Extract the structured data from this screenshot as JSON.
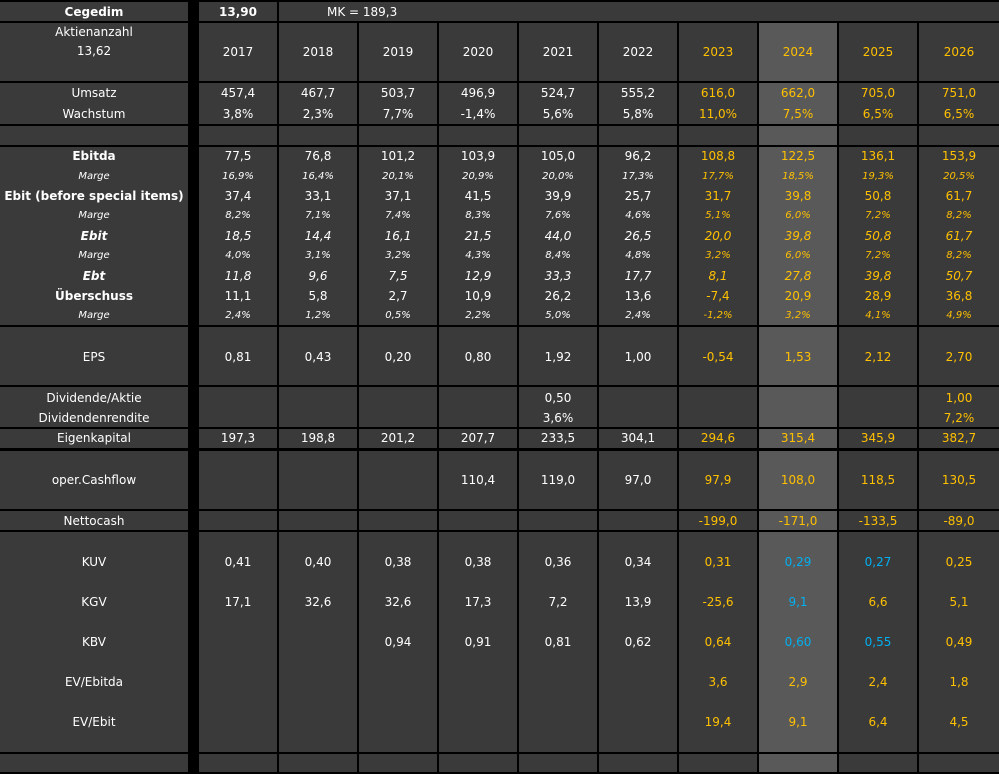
{
  "header": {
    "company": "Cegedim",
    "price": "13,90",
    "market_cap": "MK = 189,3",
    "shares_label": "Aktienanzahl",
    "shares_value": "13,62"
  },
  "years": [
    "2017",
    "2018",
    "2019",
    "2020",
    "2021",
    "2022",
    "2023",
    "2024",
    "2025",
    "2026"
  ],
  "rows": [
    {
      "label": "Umsatz",
      "values": [
        "457,4",
        "467,7",
        "503,7",
        "496,9",
        "524,7",
        "555,2",
        "616,0",
        "662,0",
        "705,0",
        "751,0"
      ]
    },
    {
      "label": "Wachstum",
      "values": [
        "3,8%",
        "2,3%",
        "7,7%",
        "-1,4%",
        "5,6%",
        "5,8%",
        "11,0%",
        "7,5%",
        "6,5%",
        "6,5%"
      ]
    },
    {
      "label": "Ebitda",
      "values": [
        "77,5",
        "76,8",
        "101,2",
        "103,9",
        "105,0",
        "96,2",
        "108,8",
        "122,5",
        "136,1",
        "153,9"
      ]
    },
    {
      "label": "Marge",
      "values": [
        "16,9%",
        "16,4%",
        "20,1%",
        "20,9%",
        "20,0%",
        "17,3%",
        "17,7%",
        "18,5%",
        "19,3%",
        "20,5%"
      ]
    },
    {
      "label": "Ebit (before special items)",
      "values": [
        "37,4",
        "33,1",
        "37,1",
        "41,5",
        "39,9",
        "25,7",
        "31,7",
        "39,8",
        "50,8",
        "61,7"
      ]
    },
    {
      "label": "Marge",
      "values": [
        "8,2%",
        "7,1%",
        "7,4%",
        "8,3%",
        "7,6%",
        "4,6%",
        "5,1%",
        "6,0%",
        "7,2%",
        "8,2%"
      ]
    },
    {
      "label": "Ebit",
      "values": [
        "18,5",
        "14,4",
        "16,1",
        "21,5",
        "44,0",
        "26,5",
        "20,0",
        "39,8",
        "50,8",
        "61,7"
      ]
    },
    {
      "label": "Marge",
      "values": [
        "4,0%",
        "3,1%",
        "3,2%",
        "4,3%",
        "8,4%",
        "4,8%",
        "3,2%",
        "6,0%",
        "7,2%",
        "8,2%"
      ]
    },
    {
      "label": "Ebt",
      "values": [
        "11,8",
        "9,6",
        "7,5",
        "12,9",
        "33,3",
        "17,7",
        "8,1",
        "27,8",
        "39,8",
        "50,7"
      ]
    },
    {
      "label": "Überschuss",
      "values": [
        "11,1",
        "5,8",
        "2,7",
        "10,9",
        "26,2",
        "13,6",
        "-7,4",
        "20,9",
        "28,9",
        "36,8"
      ]
    },
    {
      "label": "Marge",
      "values": [
        "2,4%",
        "1,2%",
        "0,5%",
        "2,2%",
        "5,0%",
        "2,4%",
        "-1,2%",
        "3,2%",
        "4,1%",
        "4,9%"
      ]
    },
    {
      "label": "EPS",
      "values": [
        "0,81",
        "0,43",
        "0,20",
        "0,80",
        "1,92",
        "1,00",
        "-0,54",
        "1,53",
        "2,12",
        "2,70"
      ]
    },
    {
      "label": "Dividende/Aktie",
      "values": [
        "",
        "",
        "",
        "",
        "0,50",
        "",
        "",
        "",
        "",
        "1,00"
      ]
    },
    {
      "label": "Dividendenrendite",
      "values": [
        "",
        "",
        "",
        "",
        "3,6%",
        "",
        "",
        "",
        "",
        "7,2%"
      ]
    },
    {
      "label": "Eigenkapital",
      "values": [
        "197,3",
        "198,8",
        "201,2",
        "207,7",
        "233,5",
        "304,1",
        "294,6",
        "315,4",
        "345,9",
        "382,7"
      ]
    },
    {
      "label": "oper.Cashflow",
      "values": [
        "",
        "",
        "",
        "110,4",
        "119,0",
        "97,0",
        "97,9",
        "108,0",
        "118,5",
        "130,5"
      ]
    },
    {
      "label": "Nettocash",
      "values": [
        "",
        "",
        "",
        "",
        "",
        "",
        "-199,0",
        "-171,0",
        "-133,5",
        "-89,0"
      ]
    },
    {
      "label": "KUV",
      "values": [
        "0,41",
        "0,40",
        "0,38",
        "0,38",
        "0,36",
        "0,34",
        "0,31",
        "0,29",
        "0,27",
        "0,25"
      ]
    },
    {
      "label": "KGV",
      "values": [
        "17,1",
        "32,6",
        "32,6",
        "17,3",
        "7,2",
        "13,9",
        "-25,6",
        "9,1",
        "6,6",
        "5,1"
      ]
    },
    {
      "label": "KBV",
      "values": [
        "",
        "",
        "0,94",
        "0,91",
        "0,81",
        "0,62",
        "0,64",
        "0,60",
        "0,55",
        "0,49"
      ]
    },
    {
      "label": "EV/Ebitda",
      "values": [
        "",
        "",
        "",
        "",
        "",
        "",
        "3,6",
        "2,9",
        "2,4",
        "1,8"
      ]
    },
    {
      "label": "EV/Ebit",
      "values": [
        "",
        "",
        "",
        "",
        "",
        "",
        "19,4",
        "9,1",
        "6,4",
        "4,5"
      ]
    }
  ],
  "colors": {
    "cell_bg": "#3a3a3a",
    "highlight_bg": "#595959",
    "grid": "#000000",
    "text": "#ffffff",
    "forecast": "#ffc000",
    "accent_blue": "#00b0f0"
  }
}
